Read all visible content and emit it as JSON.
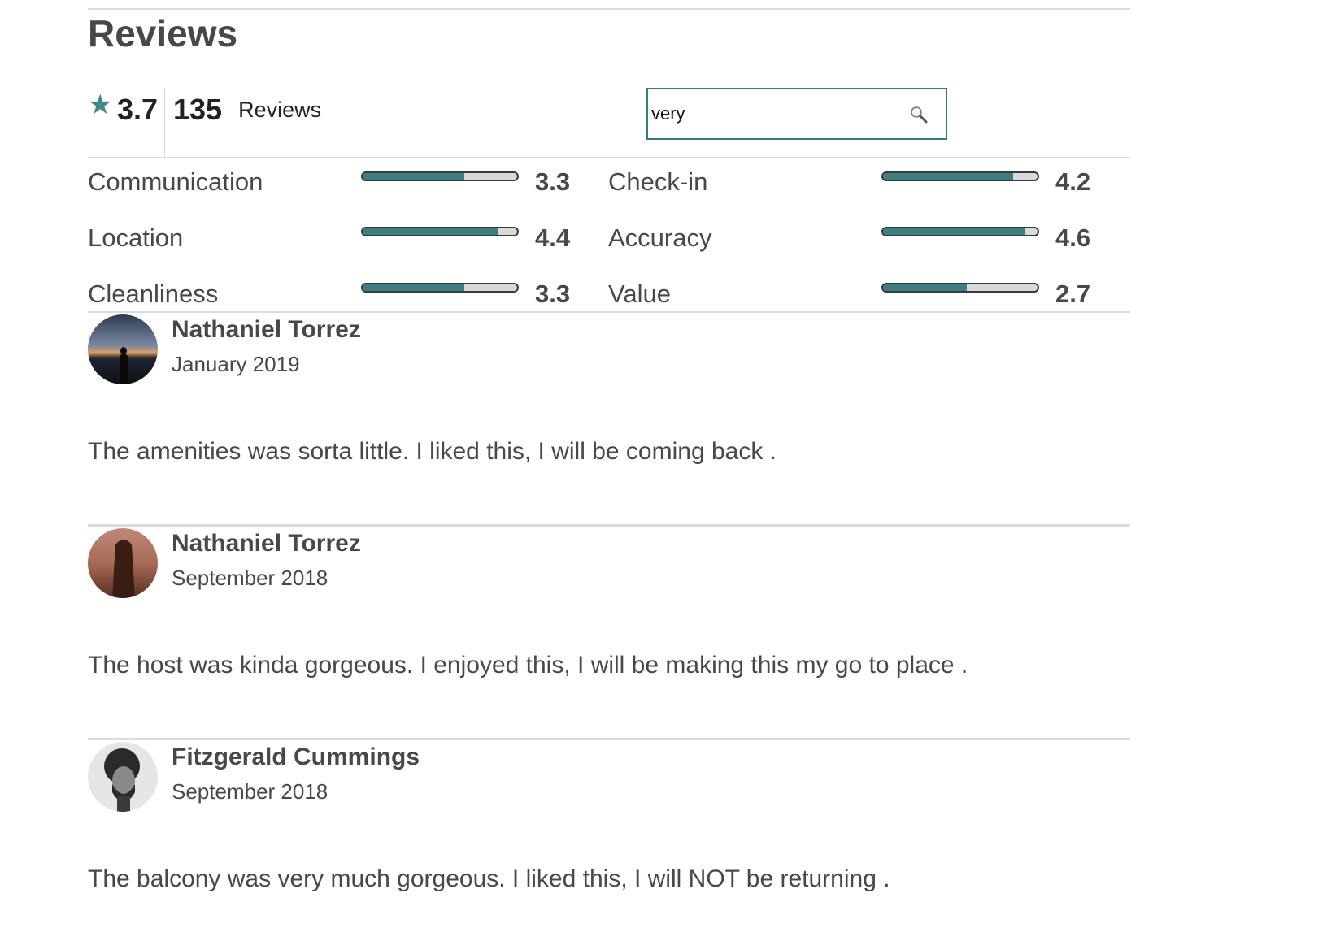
{
  "header": {
    "title": "Reviews"
  },
  "summary": {
    "star_icon": "star-icon",
    "average": "3.7",
    "count": "135",
    "count_label": "Reviews"
  },
  "search": {
    "value": "very",
    "icon": "magnifier-icon"
  },
  "accent_color": "#3c7f83",
  "ratings": [
    {
      "label": "Communication",
      "value": "3.3",
      "fraction": 0.66
    },
    {
      "label": "Check-in",
      "value": "4.2",
      "fraction": 0.84
    },
    {
      "label": "Location",
      "value": "4.4",
      "fraction": 0.88
    },
    {
      "label": "Accuracy",
      "value": "4.6",
      "fraction": 0.92
    },
    {
      "label": "Cleanliness",
      "value": "3.3",
      "fraction": 0.66
    },
    {
      "label": "Value",
      "value": "2.7",
      "fraction": 0.54
    }
  ],
  "reviews": [
    {
      "name": "Nathaniel Torrez",
      "date": "January 2019",
      "text": "The amenities was sorta little. I liked this, I will be coming back ."
    },
    {
      "name": "Nathaniel Torrez",
      "date": "September 2018",
      "text": "The host was kinda gorgeous. I enjoyed this, I will be making this my go to place ."
    },
    {
      "name": "Fitzgerald Cummings",
      "date": "September 2018",
      "text": "The balcony was very much gorgeous. I liked this, I will NOT be returning ."
    }
  ]
}
